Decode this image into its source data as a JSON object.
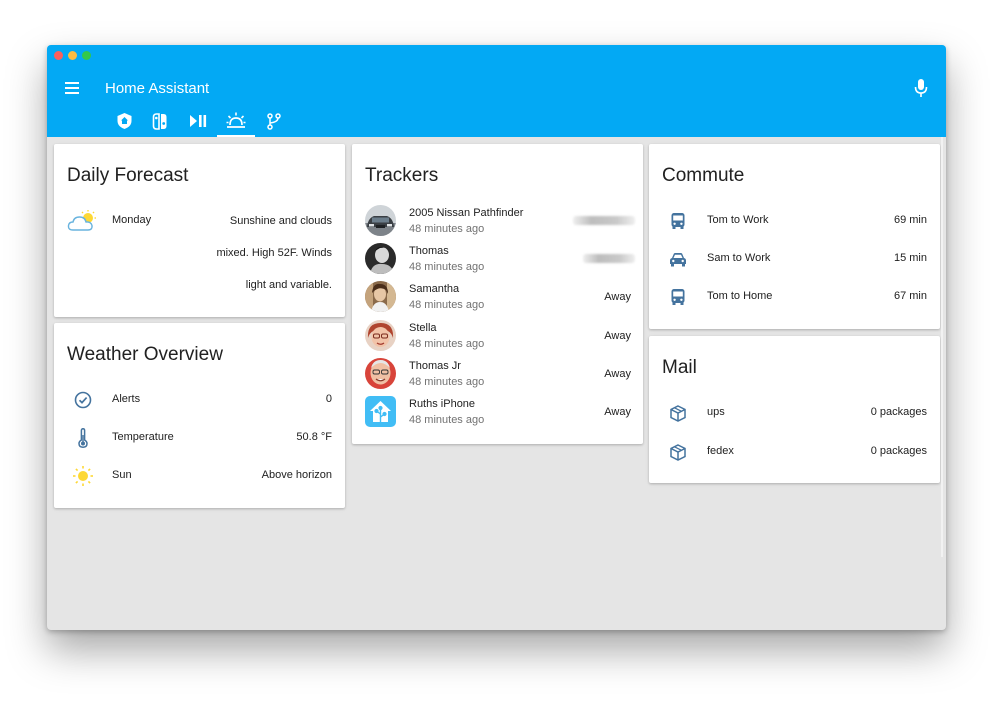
{
  "app": {
    "title": "Home Assistant"
  },
  "tabs": [
    {
      "icon": "home-assistant-icon"
    },
    {
      "icon": "nintendo-switch-icon"
    },
    {
      "icon": "play-pause-icon"
    },
    {
      "icon": "weather-sunset-icon",
      "active": true
    },
    {
      "icon": "source-branch-icon"
    }
  ],
  "colors": {
    "header": "#03a9f4",
    "icon": "#44739e",
    "sun": "#fdd835",
    "background": "#e5e5e5"
  },
  "daily_forecast": {
    "title": "Daily Forecast",
    "day": "Monday",
    "icon": "partly-cloudy-icon",
    "lines": [
      "Sunshine and clouds",
      "mixed. High 52F. Winds",
      "light and variable."
    ]
  },
  "weather_overview": {
    "title": "Weather Overview",
    "rows": [
      {
        "icon": "check-circle-icon",
        "name": "Alerts",
        "state": "0"
      },
      {
        "icon": "thermometer-icon",
        "name": "Temperature",
        "state": "50.8 °F"
      },
      {
        "icon": "sun-icon",
        "name": "Sun",
        "state": "Above horizon"
      }
    ]
  },
  "trackers": {
    "title": "Trackers",
    "items": [
      {
        "name": "2005 Nissan Pathfinder",
        "time": "48 minutes ago",
        "state": "",
        "avatar": "car-avatar"
      },
      {
        "name": "Thomas",
        "time": "48 minutes ago",
        "state": "",
        "avatar": "person-avatar"
      },
      {
        "name": "Samantha",
        "time": "48 minutes ago",
        "state": "Away",
        "avatar": "person-avatar"
      },
      {
        "name": "Stella",
        "time": "48 minutes ago",
        "state": "Away",
        "avatar": "person-avatar"
      },
      {
        "name": "Thomas Jr",
        "time": "48 minutes ago",
        "state": "Away",
        "avatar": "person-avatar"
      },
      {
        "name": "Ruths iPhone",
        "time": "48 minutes ago",
        "state": "Away",
        "avatar": "home-assistant-avatar"
      }
    ]
  },
  "commute": {
    "title": "Commute",
    "rows": [
      {
        "icon": "bus-icon",
        "name": "Tom to Work",
        "state": "69 min"
      },
      {
        "icon": "car-icon",
        "name": "Sam to Work",
        "state": "15 min"
      },
      {
        "icon": "bus-icon",
        "name": "Tom to Home",
        "state": "67 min"
      }
    ]
  },
  "mail": {
    "title": "Mail",
    "rows": [
      {
        "icon": "package-icon",
        "name": "ups",
        "state": "0 packages"
      },
      {
        "icon": "package-icon",
        "name": "fedex",
        "state": "0 packages"
      }
    ]
  }
}
